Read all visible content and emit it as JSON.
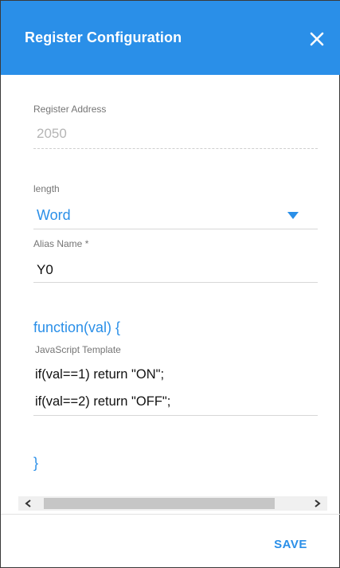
{
  "dialog": {
    "title": "Register Configuration",
    "close_icon": "close-icon",
    "header_color": "#2a8fe8"
  },
  "register_address": {
    "label": "Register Address",
    "value": "2050"
  },
  "length": {
    "label": "length",
    "selected": "Word",
    "icon": "dropdown-arrow-icon"
  },
  "alias": {
    "label": "Alias Name *",
    "value": "Y0"
  },
  "script": {
    "open": "function(val) {",
    "label": "JavaScript Template",
    "lines": [
      "if(val==1) return \"ON\";",
      "if(val==2) return \"OFF\";"
    ],
    "close": "}"
  },
  "scrollbar": {
    "left_icon": "chevron-left-icon",
    "right_icon": "chevron-right-icon"
  },
  "footer": {
    "save_label": "SAVE"
  }
}
